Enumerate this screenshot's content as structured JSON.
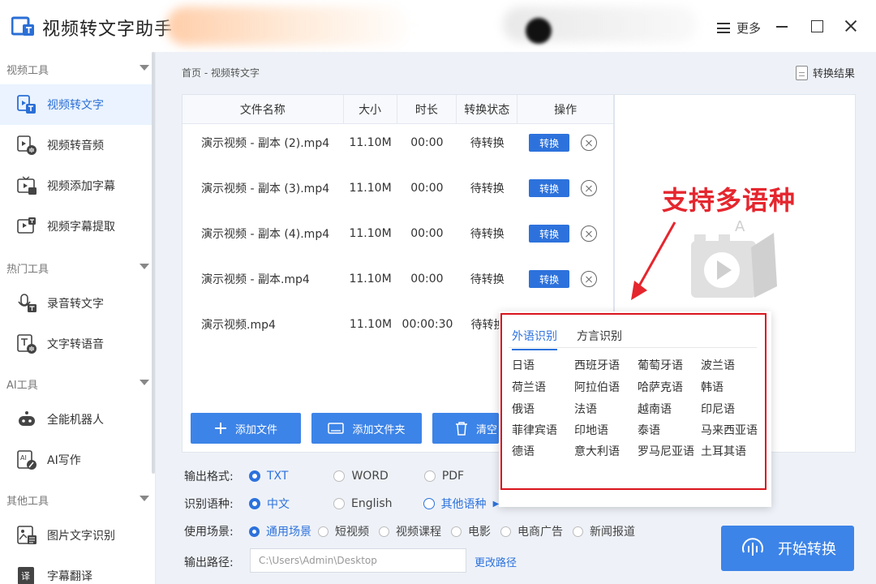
{
  "app": {
    "title": "视频转文字助手",
    "more_label": "更多"
  },
  "sidebar": {
    "groups": [
      {
        "label": "视频工具",
        "items": [
          {
            "label": "视频转文字",
            "icon": "video-to-text-icon",
            "active": true
          },
          {
            "label": "视频转音频",
            "icon": "video-to-audio-icon"
          },
          {
            "label": "视频添加字幕",
            "icon": "video-subtitle-icon"
          },
          {
            "label": "视频字幕提取",
            "icon": "subtitle-extract-icon"
          }
        ]
      },
      {
        "label": "热门工具",
        "items": [
          {
            "label": "录音转文字",
            "icon": "mic-text-icon"
          },
          {
            "label": "文字转语音",
            "icon": "text-speech-icon"
          }
        ]
      },
      {
        "label": "AI工具",
        "items": [
          {
            "label": "全能机器人",
            "icon": "robot-icon"
          },
          {
            "label": "AI写作",
            "icon": "ai-write-icon"
          }
        ]
      },
      {
        "label": "其他工具",
        "items": [
          {
            "label": "图片文字识别",
            "icon": "image-ocr-icon"
          },
          {
            "label": "字幕翻译",
            "icon": "subtitle-translate-icon"
          }
        ]
      }
    ]
  },
  "main": {
    "breadcrumb": "首页 - 视频转文字",
    "result_label": "转换结果",
    "table": {
      "headers": [
        "文件名称",
        "大小",
        "时长",
        "转换状态",
        "操作"
      ],
      "rows": [
        {
          "name": "演示视频 - 副本 (2).mp4",
          "size": "11.10M",
          "duration": "00:00",
          "status": "待转换",
          "action": "转换"
        },
        {
          "name": "演示视频 - 副本 (3).mp4",
          "size": "11.10M",
          "duration": "00:00",
          "status": "待转换",
          "action": "转换"
        },
        {
          "name": "演示视频 - 副本 (4).mp4",
          "size": "11.10M",
          "duration": "00:00",
          "status": "待转换",
          "action": "转换"
        },
        {
          "name": "演示视频 - 副本.mp4",
          "size": "11.10M",
          "duration": "00:00",
          "status": "待转换",
          "action": "转换"
        },
        {
          "name": "演示视频.mp4",
          "size": "11.10M",
          "duration": "00:00:30",
          "status": "待转换",
          "action": ""
        }
      ]
    },
    "buttons": {
      "add_file": "添加文件",
      "add_folder": "添加文件夹",
      "clear": "清空"
    },
    "output_format": {
      "label": "输出格式:",
      "options": [
        "TXT",
        "WORD",
        "PDF"
      ],
      "selected": "TXT"
    },
    "language": {
      "label": "识别语种:",
      "options": [
        "中文",
        "English",
        "其他语种"
      ],
      "selected": "中文"
    },
    "scene": {
      "label": "使用场景:",
      "options": [
        "通用场景",
        "短视频",
        "视频课程",
        "电影",
        "电商广告",
        "新闻报道"
      ],
      "selected": "通用场景"
    },
    "output_path": {
      "label": "输出路径:",
      "placeholder": "C:\\Users\\Admin\\Desktop",
      "change_label": "更改路径"
    },
    "start_button": "开始转换"
  },
  "lang_popup": {
    "tabs": [
      "外语识别",
      "方言识别"
    ],
    "active_tab": "外语识别",
    "languages": [
      "日语",
      "西班牙语",
      "葡萄牙语",
      "波兰语",
      "荷兰语",
      "阿拉伯语",
      "哈萨克语",
      "韩语",
      "俄语",
      "法语",
      "越南语",
      "印尼语",
      "菲律宾语",
      "印地语",
      "泰语",
      "马来西亚语",
      "德语",
      "意大利语",
      "罗马尼亚语",
      "土耳其语"
    ]
  },
  "annotation": {
    "text": "支持多语种",
    "color": "#e5262e"
  },
  "colors": {
    "accent": "#2d72dc",
    "button": "#3d84e8",
    "highlight": "#d9141d",
    "sidebar_active_bg": "#eaf3ff"
  }
}
